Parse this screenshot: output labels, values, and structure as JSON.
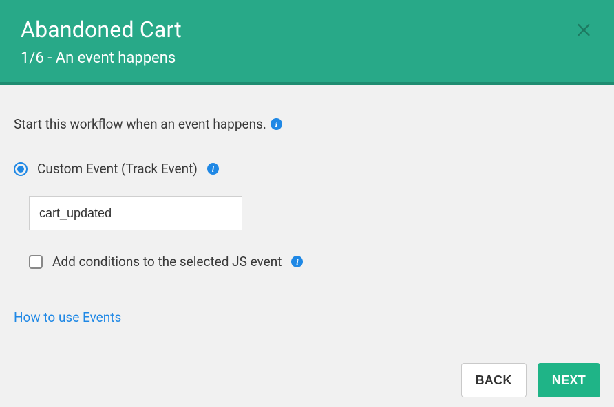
{
  "header": {
    "title": "Abandoned Cart",
    "subtitle": "1/6 - An event happens"
  },
  "body": {
    "intro": "Start this workflow when an event happens.",
    "option_label": "Custom Event (Track Event)",
    "event_value": "cart_updated",
    "condition_label": "Add conditions to the selected JS event",
    "help_link": "How to use Events"
  },
  "footer": {
    "back": "BACK",
    "next": "NEXT"
  }
}
